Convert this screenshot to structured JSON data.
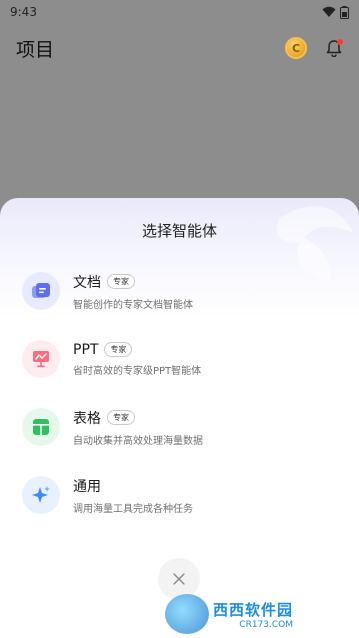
{
  "status_bar": {
    "time": "9:43"
  },
  "header": {
    "title": "项目"
  },
  "sheet": {
    "title": "选择智能体",
    "agents": [
      {
        "name": "文档",
        "badge": "专家",
        "desc": "智能创作的专家文档智能体",
        "icon": "document-icon",
        "color": "#5b6ef5",
        "bg": "#e8ebff"
      },
      {
        "name": "PPT",
        "badge": "专家",
        "desc": "省时高效的专家级PPT智能体",
        "icon": "presentation-icon",
        "color": "#ff6b7a",
        "bg": "#ffecee"
      },
      {
        "name": "表格",
        "badge": "专家",
        "desc": "自动收集并高效处理海量数据",
        "icon": "table-icon",
        "color": "#2cc35f",
        "bg": "#e6f8ec"
      },
      {
        "name": "通用",
        "badge": "",
        "desc": "调用海量工具完成各种任务",
        "icon": "sparkle-icon",
        "color": "#3a8bff",
        "bg": "#e8f1ff"
      }
    ]
  },
  "watermark": {
    "main": "西西软件园",
    "sub": "CR173.COM"
  }
}
